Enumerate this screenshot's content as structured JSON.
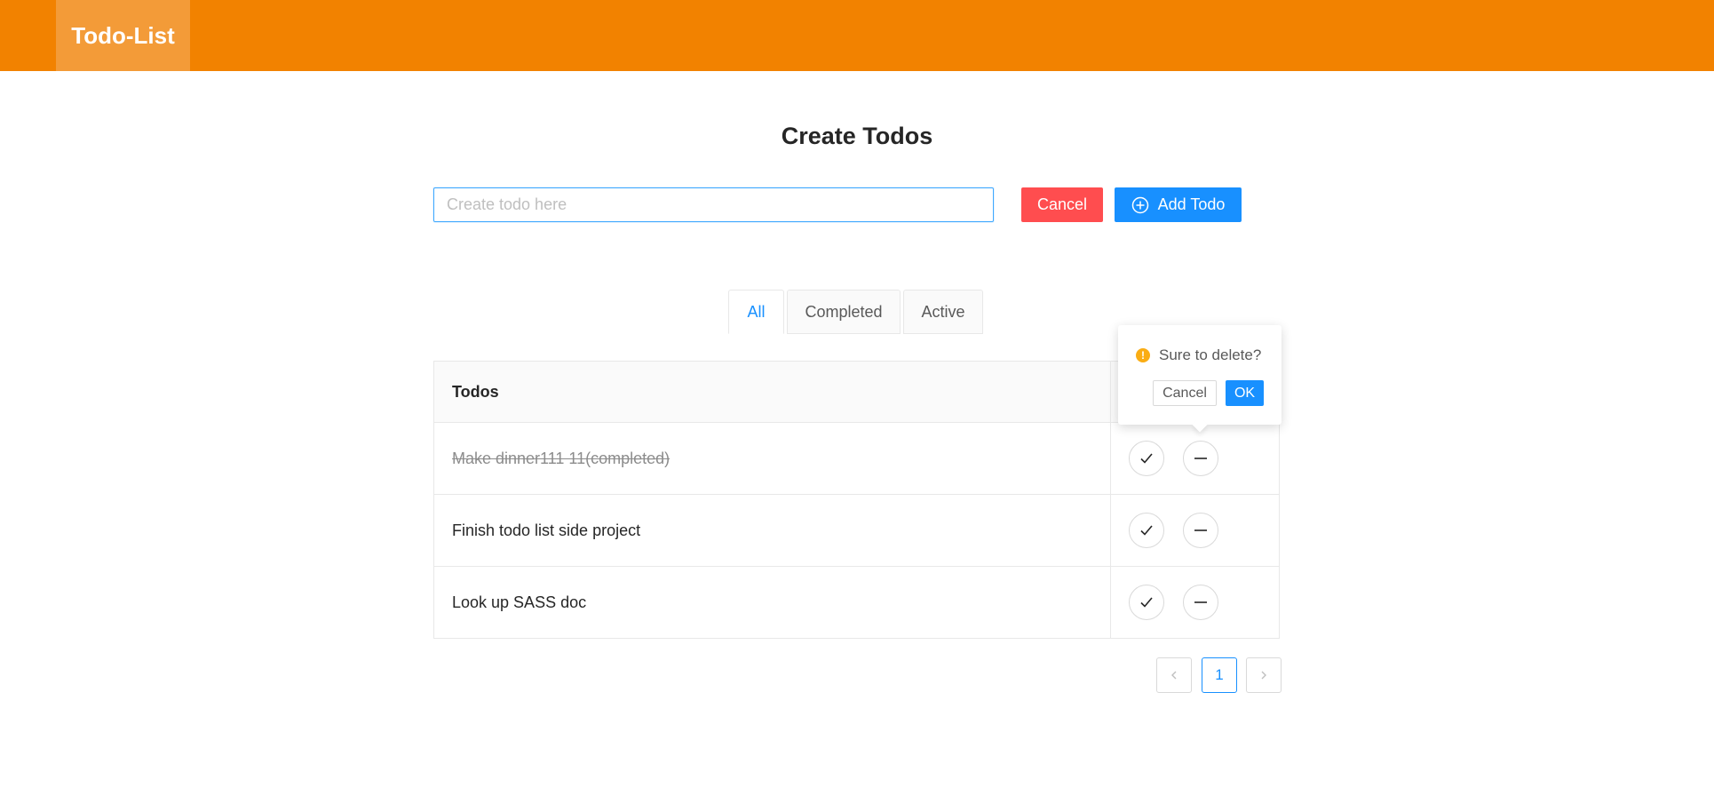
{
  "header": {
    "logo": "Todo-List",
    "color": "#f28200"
  },
  "main": {
    "title": "Create Todos",
    "input_placeholder": "Create todo here",
    "input_value": "",
    "cancel_label": "Cancel",
    "add_label": "Add Todo",
    "add_icon": "plus-circle-icon"
  },
  "tabs": [
    {
      "label": "All",
      "active": true
    },
    {
      "label": "Completed",
      "active": false
    },
    {
      "label": "Active",
      "active": false
    }
  ],
  "table": {
    "header": "Todos",
    "rows": [
      {
        "text": "Make dinner111 11(completed)",
        "completed": true,
        "icons": [
          "check-icon",
          "minus-icon"
        ]
      },
      {
        "text": "Finish todo list side project",
        "completed": false,
        "icons": [
          "check-icon",
          "minus-icon"
        ]
      },
      {
        "text": "Look up SASS doc",
        "completed": false,
        "icons": [
          "check-icon",
          "minus-icon"
        ]
      }
    ]
  },
  "popconfirm": {
    "message": "Sure to delete?",
    "icon": "exclamation-circle-icon",
    "cancel_label": "Cancel",
    "ok_label": "OK"
  },
  "pagination": {
    "current_page": "1",
    "prev_icon": "chevron-left-icon",
    "next_icon": "chevron-right-icon"
  },
  "colors": {
    "primary": "#1890ff",
    "danger": "#ff4d4f",
    "warning": "#faad14",
    "header": "#f28200",
    "logo_bg": "#f39b38"
  }
}
